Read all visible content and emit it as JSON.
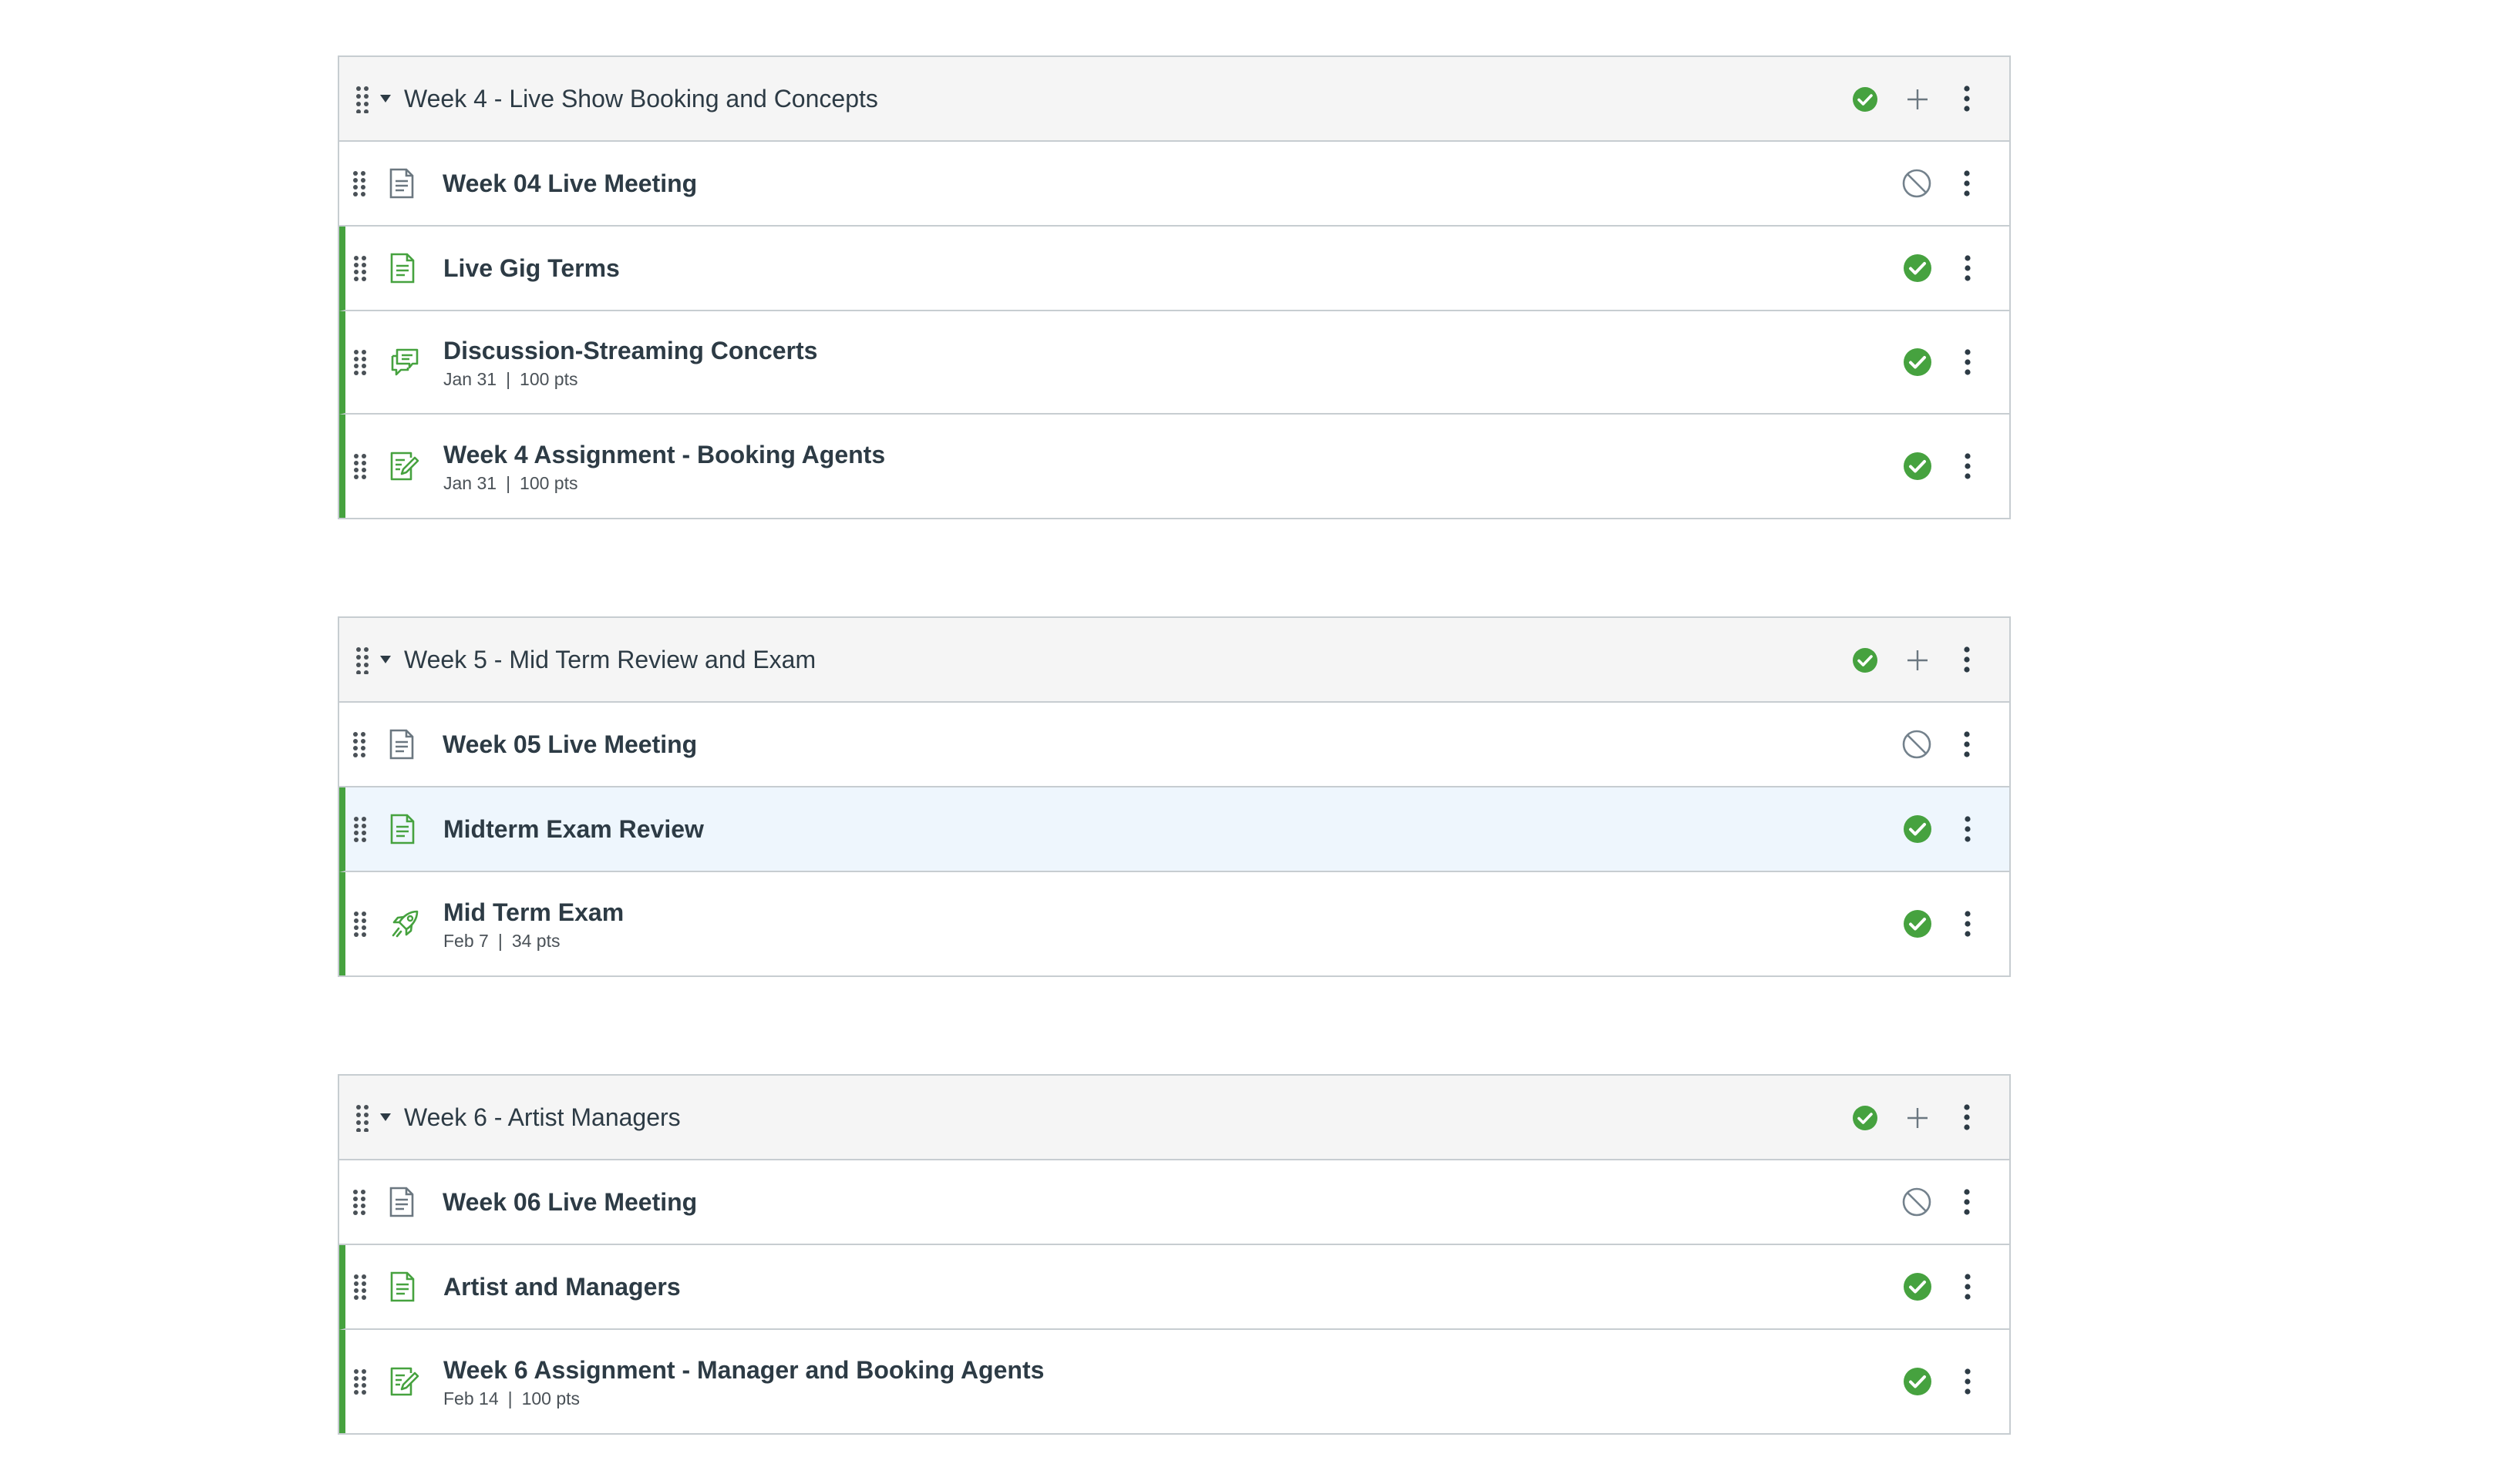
{
  "colors": {
    "published": "#46a23f",
    "border": "#c7cdd1",
    "header_bg": "#f5f5f5",
    "highlight_bg": "#eef6fd",
    "text": "#2d3b45",
    "muted_icon": "#73818c"
  },
  "modules": [
    {
      "title": "Week 4 - Live Show Booking and Concepts",
      "published": true,
      "items": [
        {
          "title": "Week 04 Live Meeting",
          "type": "page",
          "published": false,
          "date": "",
          "points": ""
        },
        {
          "title": "Live Gig Terms",
          "type": "page",
          "published": true,
          "date": "",
          "points": ""
        },
        {
          "title": "Discussion-Streaming Concerts",
          "type": "discussion",
          "published": true,
          "date": "Jan 31",
          "points": "100 pts"
        },
        {
          "title": "Week 4 Assignment - Booking Agents",
          "type": "assignment",
          "published": true,
          "date": "Jan 31",
          "points": "100 pts"
        }
      ]
    },
    {
      "title": "Week 5 - Mid Term Review and Exam",
      "published": true,
      "items": [
        {
          "title": "Week 05 Live Meeting",
          "type": "page",
          "published": false,
          "date": "",
          "points": ""
        },
        {
          "title": "Midterm Exam Review",
          "type": "page",
          "published": true,
          "date": "",
          "points": ""
        },
        {
          "title": "Mid Term Exam",
          "type": "quiz",
          "published": true,
          "date": "Feb 7",
          "points": "34 pts"
        }
      ]
    },
    {
      "title": "Week 6 - Artist Managers",
      "published": true,
      "items": [
        {
          "title": "Week 06 Live Meeting",
          "type": "page",
          "published": false,
          "date": "",
          "points": ""
        },
        {
          "title": "Artist and Managers",
          "type": "page",
          "published": true,
          "date": "",
          "points": ""
        },
        {
          "title": "Week 6 Assignment - Manager and Booking Agents",
          "type": "assignment",
          "published": true,
          "date": "Feb 14",
          "points": "100 pts"
        }
      ]
    }
  ],
  "separator": "|"
}
